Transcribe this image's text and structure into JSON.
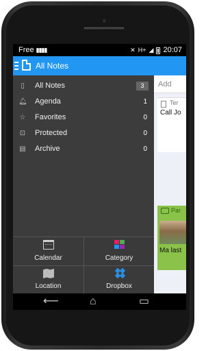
{
  "status_bar": {
    "carrier": "Free",
    "signal_icon": "signal-bars-icon",
    "network": "H+",
    "time": "20:07"
  },
  "action_bar": {
    "title": "All Notes",
    "menu_icon": "drawer-menu-icon",
    "app_icon": "note-icon",
    "color": "#2196f3"
  },
  "drawer": {
    "items": [
      {
        "label": "All Notes",
        "count": "3",
        "icon": "note-icon"
      },
      {
        "label": "Agenda",
        "count": "1",
        "icon": "bell-icon"
      },
      {
        "label": "Favorites",
        "count": "0",
        "icon": "star-icon"
      },
      {
        "label": "Protected",
        "count": "0",
        "icon": "lock-icon"
      },
      {
        "label": "Archive",
        "count": "0",
        "icon": "archive-icon"
      }
    ],
    "tiles": [
      {
        "label": "Calendar",
        "icon": "calendar-icon"
      },
      {
        "label": "Category",
        "icon": "category-icon"
      },
      {
        "label": "Location",
        "icon": "map-icon"
      },
      {
        "label": "Dropbox",
        "icon": "dropbox-icon"
      }
    ]
  },
  "content": {
    "add_placeholder": "Add",
    "note1": {
      "tag": "Ter",
      "text": "Call Jo"
    },
    "note2": {
      "tag": "Par",
      "text": "Ma last"
    }
  },
  "colors": {
    "drawer_bg": "#3c3c3c",
    "accent": "#2196f3",
    "note_green": "#8bc34a"
  }
}
